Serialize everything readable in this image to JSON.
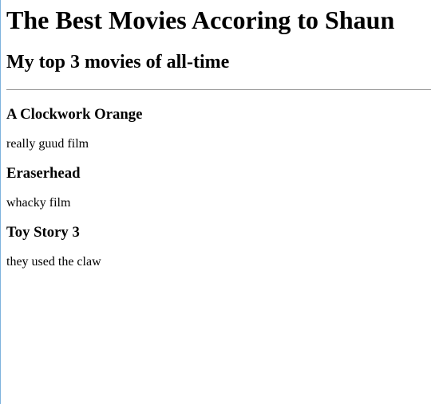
{
  "header": {
    "title": "The Best Movies Accoring to Shaun",
    "subtitle": "My top 3 movies of all-time"
  },
  "movies": [
    {
      "title": "A Clockwork Orange",
      "description": "really guud film"
    },
    {
      "title": "Eraserhead",
      "description": "whacky film"
    },
    {
      "title": "Toy Story 3",
      "description": "they used the claw"
    }
  ]
}
